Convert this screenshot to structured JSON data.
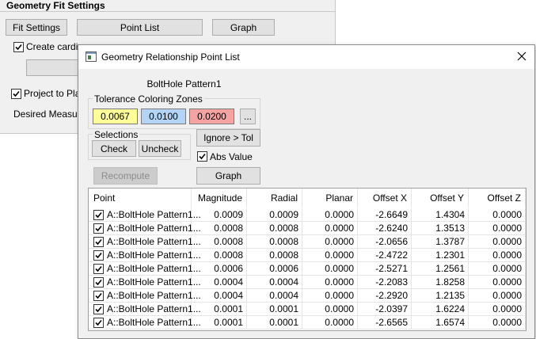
{
  "bg": {
    "title": "Geometry Fit Settings",
    "fit_settings": "Fit Settings",
    "point_list": "Point List",
    "graph": "Graph",
    "create_cardin": "Create cardin",
    "project_to_plan": "Project to Plan",
    "desired_measure": "Desired Measure"
  },
  "dialog": {
    "title": "Geometry Relationship Point List",
    "pattern_name": "BoltHole Pattern1",
    "tolerance_group": "Tolerance Coloring Zones",
    "tolerances": [
      {
        "value": "0.0067",
        "color": "#ffff99"
      },
      {
        "value": "0.0100",
        "color": "#b3d4f5"
      },
      {
        "value": "0.0200",
        "color": "#f5a3a3"
      }
    ],
    "ellipsis": "...",
    "selections_group": "Selections",
    "check": "Check",
    "uncheck": "Uncheck",
    "ignore_tol": "Ignore > Tol",
    "abs_value": "Abs Value",
    "recompute": "Recompute",
    "graph": "Graph",
    "columns": [
      "Point",
      "Magnitude",
      "Radial",
      "Planar",
      "Offset X",
      "Offset Y",
      "Offset Z"
    ],
    "rows": [
      [
        "A::BoltHole Pattern1...",
        "0.0009",
        "0.0009",
        "0.0000",
        "-2.6649",
        "1.4304",
        "0.0000"
      ],
      [
        "A::BoltHole Pattern1...",
        "0.0008",
        "0.0008",
        "0.0000",
        "-2.6240",
        "1.3513",
        "0.0000"
      ],
      [
        "A::BoltHole Pattern1...",
        "0.0008",
        "0.0008",
        "0.0000",
        "-2.0656",
        "1.3787",
        "0.0000"
      ],
      [
        "A::BoltHole Pattern1...",
        "0.0008",
        "0.0008",
        "0.0000",
        "-2.4722",
        "1.2301",
        "0.0000"
      ],
      [
        "A::BoltHole Pattern1...",
        "0.0006",
        "0.0006",
        "0.0000",
        "-2.5271",
        "1.2561",
        "0.0000"
      ],
      [
        "A::BoltHole Pattern1...",
        "0.0004",
        "0.0004",
        "0.0000",
        "-2.2083",
        "1.8258",
        "0.0000"
      ],
      [
        "A::BoltHole Pattern1...",
        "0.0004",
        "0.0004",
        "0.0000",
        "-2.2920",
        "1.2135",
        "0.0000"
      ],
      [
        "A::BoltHole Pattern1...",
        "0.0001",
        "0.0001",
        "0.0000",
        "-2.0397",
        "1.6224",
        "0.0000"
      ],
      [
        "A::BoltHole Pattern1...",
        "0.0001",
        "0.0001",
        "0.0000",
        "-2.6565",
        "1.6574",
        "0.0000"
      ]
    ]
  }
}
